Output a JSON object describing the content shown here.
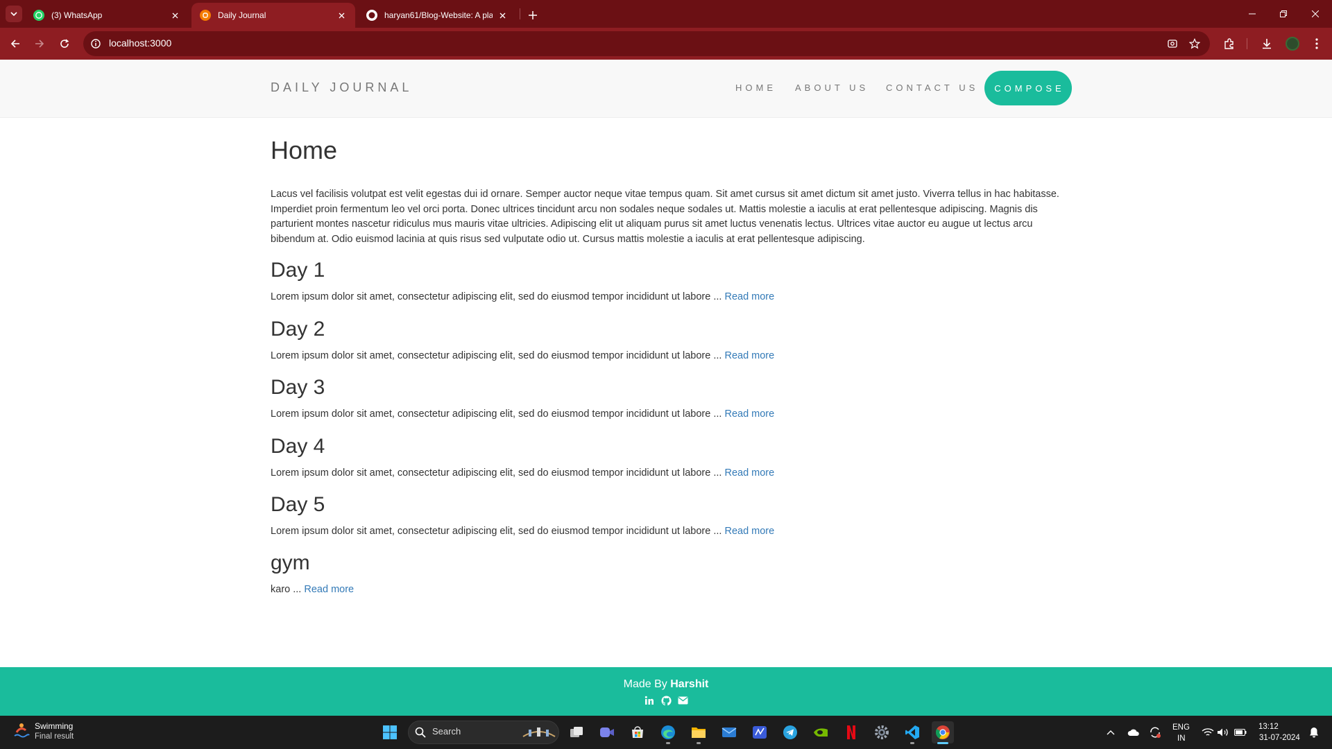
{
  "browser": {
    "tabs": [
      {
        "title": "(3) WhatsApp",
        "badge": "3",
        "active": false
      },
      {
        "title": "Daily Journal",
        "active": true
      },
      {
        "title": "haryan61/Blog-Website: A plac",
        "active": false
      }
    ],
    "url": "localhost:3000",
    "accent": "#8e1d22"
  },
  "site": {
    "brand": "DAILY JOURNAL",
    "nav": [
      "HOME",
      "ABOUT US",
      "CONTACT US"
    ],
    "compose": "COMPOSE",
    "accent": "#1abc9c"
  },
  "page": {
    "title": "Home",
    "intro": "Lacus vel facilisis volutpat est velit egestas dui id ornare. Semper auctor neque vitae tempus quam. Sit amet cursus sit amet dictum sit amet justo. Viverra tellus in hac habitasse. Imperdiet proin fermentum leo vel orci porta. Donec ultrices tincidunt arcu non sodales neque sodales ut. Mattis molestie a iaculis at erat pellentesque adipiscing. Magnis dis parturient montes nascetur ridiculus mus mauris vitae ultricies. Adipiscing elit ut aliquam purus sit amet luctus venenatis lectus. Ultrices vitae auctor eu augue ut lectus arcu bibendum at. Odio euismod lacinia at quis risus sed vulputate odio ut. Cursus mattis molestie a iaculis at erat pellentesque adipiscing.",
    "posts": [
      {
        "title": "Day 1",
        "excerpt": "Lorem ipsum dolor sit amet, consectetur adipiscing elit, sed do eiusmod tempor incididunt ut labore",
        "ellipsis": " ... ",
        "more": "Read more"
      },
      {
        "title": "Day 2",
        "excerpt": "Lorem ipsum dolor sit amet, consectetur adipiscing elit, sed do eiusmod tempor incididunt ut labore",
        "ellipsis": " ... ",
        "more": "Read more"
      },
      {
        "title": "Day 3",
        "excerpt": "Lorem ipsum dolor sit amet, consectetur adipiscing elit, sed do eiusmod tempor incididunt ut labore",
        "ellipsis": " ... ",
        "more": "Read more"
      },
      {
        "title": "Day 4",
        "excerpt": "Lorem ipsum dolor sit amet, consectetur adipiscing elit, sed do eiusmod tempor incididunt ut labore",
        "ellipsis": " ... ",
        "more": "Read more"
      },
      {
        "title": "Day 5",
        "excerpt": "Lorem ipsum dolor sit amet, consectetur adipiscing elit, sed do eiusmod tempor incididunt ut labore",
        "ellipsis": " ... ",
        "more": "Read more"
      },
      {
        "title": "gym",
        "excerpt": "karo",
        "ellipsis": " ... ",
        "more": "Read more"
      }
    ]
  },
  "footer": {
    "prefix": "Made By ",
    "author": "Harshit",
    "icons": [
      "linkedin-icon",
      "github-icon",
      "mail-icon"
    ]
  },
  "taskbar": {
    "weather_title": "Swimming",
    "weather_sub": "Final result",
    "search": "Search",
    "lang_line1": "ENG",
    "lang_line2": "IN",
    "time": "13:12",
    "date": "31-07-2024"
  }
}
